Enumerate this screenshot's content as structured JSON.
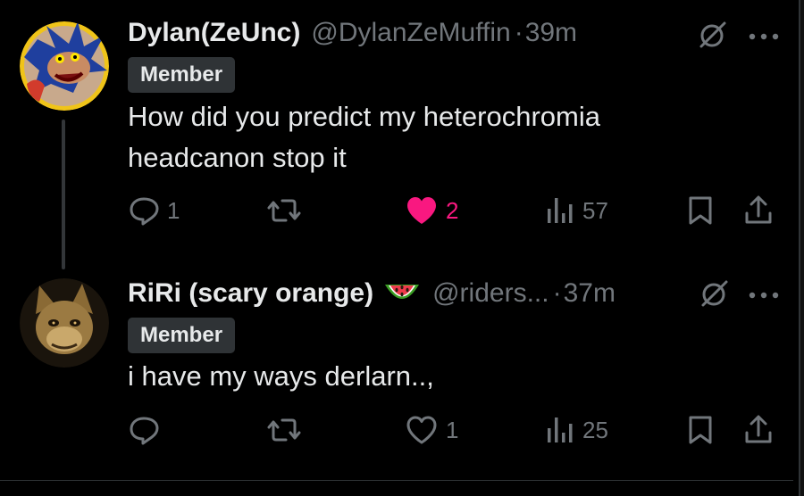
{
  "posts": [
    {
      "display_name": "Dylan(ZeUnc)",
      "handle": "@DylanZeMuffin",
      "separator": "·",
      "timestamp": "39m",
      "badge": "Member",
      "text_line1": "How did you predict my heterochromia",
      "text_line2": "headcanon stop it",
      "reply_count": "1",
      "repost_count": "",
      "like_count": "2",
      "liked": true,
      "views": "57",
      "avatar_icon": "evil-hedgehog-avatar"
    },
    {
      "display_name": "RiRi (scary orange)",
      "emoji": "watermelon",
      "handle": "@riders...",
      "separator": "·",
      "timestamp": "37m",
      "badge": "Member",
      "text_line1": "i have my ways derlarn..,",
      "reply_count": "",
      "repost_count": "",
      "like_count": "1",
      "liked": false,
      "views": "25",
      "avatar_icon": "creepy-fox-avatar"
    }
  ],
  "colors": {
    "background": "#000000",
    "text": "#e7e9ea",
    "secondary": "#71767b",
    "like": "#f91880",
    "badge_bg": "#2f3336"
  }
}
